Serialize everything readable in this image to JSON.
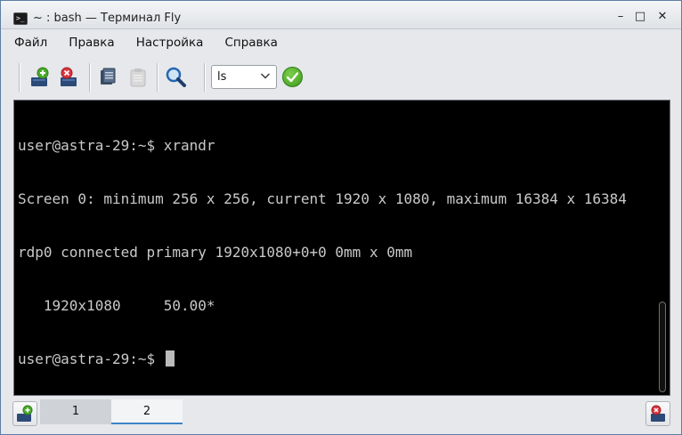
{
  "window": {
    "title": "~ : bash — Терминал Fly",
    "app_icon_text": ">_",
    "controls": {
      "minimize": "–",
      "maximize": "□",
      "close": "✕"
    }
  },
  "menu": {
    "items": [
      {
        "label": "Файл"
      },
      {
        "label": "Правка"
      },
      {
        "label": "Настройка"
      },
      {
        "label": "Справка"
      }
    ]
  },
  "toolbar": {
    "buttons": [
      {
        "icon": "new-tab-icon"
      },
      {
        "icon": "close-tab-icon"
      },
      {
        "icon": "copy-icon"
      },
      {
        "icon": "paste-icon"
      },
      {
        "icon": "search-icon"
      }
    ],
    "command_select": {
      "value": "ls"
    },
    "run_icon": "checkmark-icon",
    "colors": {
      "run": "#3c9a1d",
      "add": "#4caa2f",
      "remove": "#d9363e",
      "search": "#2466b4"
    }
  },
  "terminal": {
    "lines": [
      "user@astra-29:~$ xrandr",
      "Screen 0: minimum 256 x 256, current 1920 x 1080, maximum 16384 x 16384",
      "rdp0 connected primary 1920x1080+0+0 0mm x 0mm",
      "   1920x1080     50.00*"
    ],
    "prompt": "user@astra-29:~$ ",
    "background": "#000000",
    "foreground": "#c9c9c9"
  },
  "tabs": {
    "items": [
      {
        "label": "1",
        "active": false
      },
      {
        "label": "2",
        "active": true
      }
    ]
  }
}
